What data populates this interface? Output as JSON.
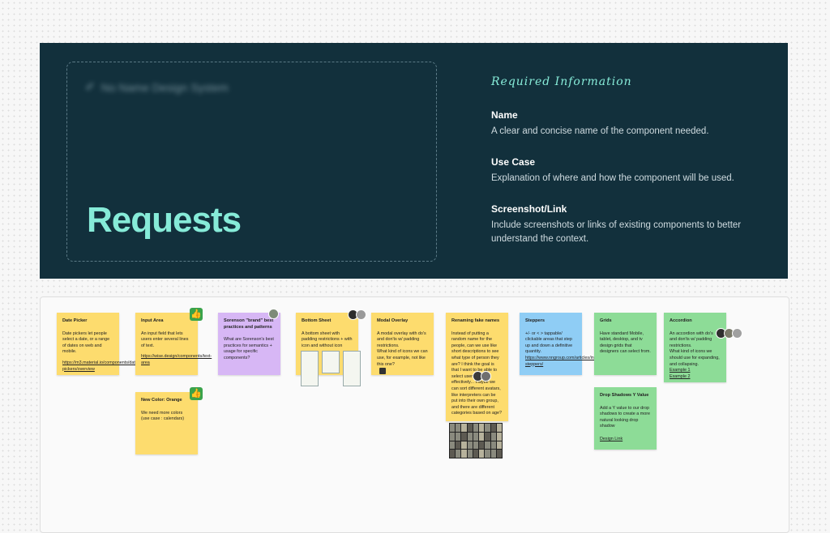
{
  "header": {
    "brand": "No Name Design System",
    "title": "Requests",
    "info_heading": "Required Information",
    "fields": [
      {
        "label": "Name",
        "desc": "A clear and concise name of the component needed."
      },
      {
        "label": "Use Case",
        "desc": "Explanation of where and how the component will be used."
      },
      {
        "label": "Screenshot/Link",
        "desc": "Include screenshots or links of existing components to better understand the context."
      }
    ]
  },
  "notes": [
    {
      "title": "Date Picker",
      "body": "Date pickers let people select a date, or a range of dates on web and mobile.",
      "link": "https://m3.material.io/components/date-pickers/overview",
      "color": "#fddc6e"
    },
    {
      "title": "Input Area",
      "body": "An input field that lets users enter several lines of text.",
      "link": "https://wise.design/components/text-area",
      "color": "#fddc6e",
      "icon": "thumbs-up-icon"
    },
    {
      "title": "New Color: Orange",
      "body": "We need more colors (use case : calendars)",
      "color": "#fddc6e",
      "icon": "thumbs-up-icon"
    },
    {
      "title": "Sorenson \"brand\" best practices and patterns",
      "body": "What are Sorenson's best practices for semantics + usage for specific components?",
      "color": "#d7b7f5"
    },
    {
      "title": "Bottom Sheet",
      "body": "A bottom sheet with padding restrictions + with icon and without icon",
      "color": "#fddc6e"
    },
    {
      "title": "Modal Overlay",
      "body": "A modal overlay with do's and don'ts w/ padding restrictions.\nWhat kind of icons we can use, for example, not like this one?",
      "color": "#fddc6e"
    },
    {
      "title": "Renaming fake names",
      "body": "Instead of putting a random name for the people, can we use like short descriptions to see what type of person they are? I think the goal is that I want to be able to select user pictures effectively... maybe we can sort different avatars, like interpreters can be put into their own group, and there are different categories based on age?",
      "color": "#fddc6e"
    },
    {
      "title": "Steppers",
      "body": "+/- or < > tappable/ clickable areas that step up and down a definitive quantity.",
      "link": "https://www.nngroup.com/articles/input-steppers/",
      "color": "#8fcdf5"
    },
    {
      "title": "Grids",
      "body": "Have standard Mobile, tablet, desktop, and tv design grids that designers can select from.",
      "color": "#8ddc97"
    },
    {
      "title": "Drop Shadows Y Value",
      "body": "Add a Y value to our drop shadows to create a more natural looking drop shadow",
      "link": "Design Link",
      "color": "#8ddc97"
    },
    {
      "title": "Accordion",
      "body": "An accordion with do's and don'ts w/ padding restrictions.\nWhat kind of icons we should use for expanding, and collapsing.",
      "link": "Example 1\nExample 2",
      "color": "#8ddc97"
    }
  ]
}
